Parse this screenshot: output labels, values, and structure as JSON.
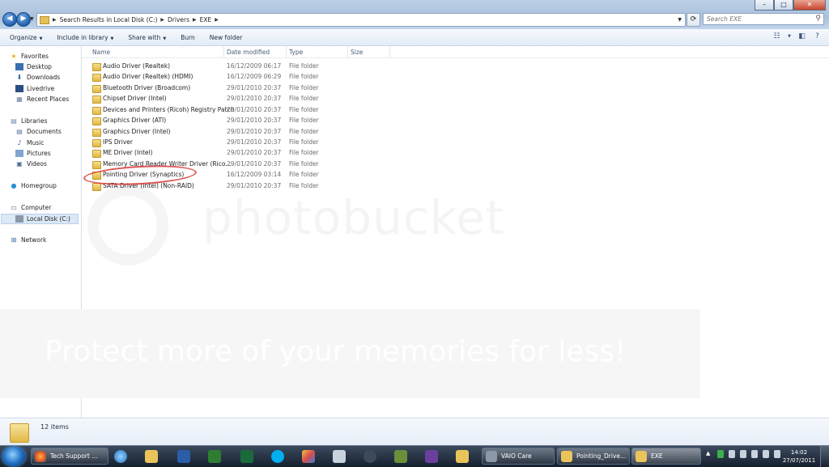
{
  "window": {
    "controls": {
      "minimize": "–",
      "maximize": "□",
      "close": "✕"
    },
    "back_label": "◀",
    "forward_label": "▶",
    "breadcrumb": [
      "Search Results in Local Disk (C:)",
      "Drivers",
      "EXE"
    ],
    "search_placeholder": "Search EXE"
  },
  "toolbar": {
    "organize": "Organize",
    "include": "Include in library",
    "share": "Share with",
    "burn": "Burn",
    "new_folder": "New folder"
  },
  "nav": {
    "favorites": "Favorites",
    "desktop": "Desktop",
    "downloads": "Downloads",
    "livedrive": "Livedrive",
    "recent": "Recent Places",
    "libraries": "Libraries",
    "documents": "Documents",
    "music": "Music",
    "pictures": "Pictures",
    "videos": "Videos",
    "homegroup": "Homegroup",
    "computer": "Computer",
    "localdisk": "Local Disk (C:)",
    "network": "Network"
  },
  "columns": {
    "name": "Name",
    "date": "Date modified",
    "type": "Type",
    "size": "Size"
  },
  "files": [
    {
      "name": "Audio Driver (Realtek)",
      "date": "16/12/2009 06:17",
      "type": "File folder"
    },
    {
      "name": "Audio Driver (Realtek) (HDMI)",
      "date": "16/12/2009 06:29",
      "type": "File folder"
    },
    {
      "name": "Bluetooth Driver (Broadcom)",
      "date": "29/01/2010 20:37",
      "type": "File folder"
    },
    {
      "name": "Chipset Driver (Intel)",
      "date": "29/01/2010 20:37",
      "type": "File folder"
    },
    {
      "name": "Devices and Printers (Ricoh) Registry Patch",
      "date": "29/01/2010 20:37",
      "type": "File folder"
    },
    {
      "name": "Graphics Driver (ATI)",
      "date": "29/01/2010 20:37",
      "type": "File folder"
    },
    {
      "name": "Graphics Driver (Intel)",
      "date": "29/01/2010 20:37",
      "type": "File folder"
    },
    {
      "name": "IPS Driver",
      "date": "29/01/2010 20:37",
      "type": "File folder"
    },
    {
      "name": "ME Driver (Intel)",
      "date": "29/01/2010 20:37",
      "type": "File folder"
    },
    {
      "name": "Memory Card Reader Writer Driver (Rico...",
      "date": "29/01/2010 20:37",
      "type": "File folder"
    },
    {
      "name": "Pointing Driver (Synaptics)",
      "date": "16/12/2009 03:14",
      "type": "File folder"
    },
    {
      "name": "SATA Driver (Intel) (Non-RAID)",
      "date": "29/01/2010 20:37",
      "type": "File folder"
    }
  ],
  "watermark": {
    "brand": "photobucket",
    "tagline": "Protect more of your memories for less!"
  },
  "status": {
    "items_count": "12 items"
  },
  "taskbar": {
    "tasks": [
      "Tech Support ...",
      "VAIO Care",
      "Pointing_Drive...",
      "EXE"
    ],
    "clock_time": "14:02",
    "clock_date": "27/07/2011"
  },
  "colors": {
    "accent": "#1f5fae",
    "circle": "#d93a3a",
    "taskbar": "#16202d"
  }
}
